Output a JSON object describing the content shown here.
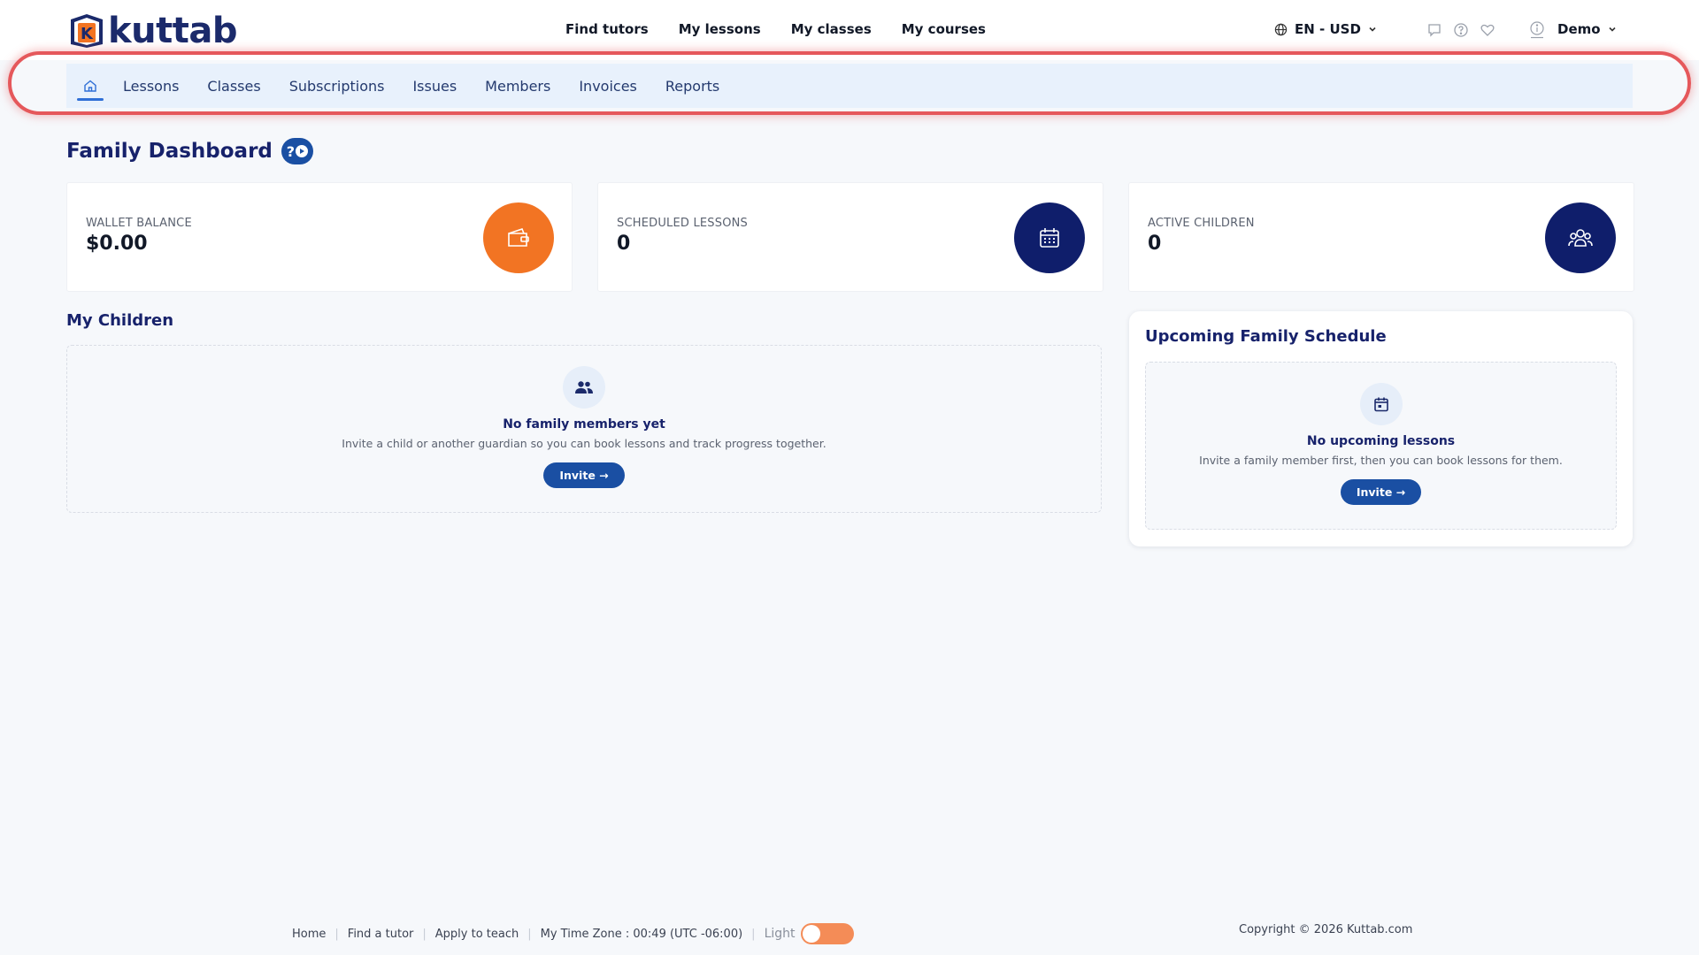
{
  "brand": {
    "name": "kuttab",
    "logo_letter": "K"
  },
  "topnav": [
    {
      "label": "Find tutors"
    },
    {
      "label": "My lessons"
    },
    {
      "label": "My classes"
    },
    {
      "label": "My courses"
    }
  ],
  "header": {
    "language_currency": "EN - USD",
    "user_name": "Demo"
  },
  "subnav": {
    "items": [
      {
        "label": "Lessons"
      },
      {
        "label": "Classes"
      },
      {
        "label": "Subscriptions"
      },
      {
        "label": "Issues"
      },
      {
        "label": "Members"
      },
      {
        "label": "Invoices"
      },
      {
        "label": "Reports"
      }
    ]
  },
  "page": {
    "title": "Family Dashboard",
    "help_glyph": "?"
  },
  "stats": [
    {
      "label": "WALLET BALANCE",
      "value": "$0.00",
      "icon": "wallet-icon",
      "color": "#f27423"
    },
    {
      "label": "SCHEDULED LESSONS",
      "value": "0",
      "icon": "calendar-icon",
      "color": "#0f1e6b"
    },
    {
      "label": "ACTIVE CHILDREN",
      "value": "0",
      "icon": "users-icon",
      "color": "#0f1e6b"
    }
  ],
  "children": {
    "title": "My Children",
    "empty_title": "No family members yet",
    "empty_desc": "Invite a child or another guardian so you can book lessons and track progress together.",
    "button": "Invite →"
  },
  "schedule": {
    "title": "Upcoming Family Schedule",
    "empty_title": "No upcoming lessons",
    "empty_desc": "Invite a family member first, then you can book lessons for them.",
    "button": "Invite →"
  },
  "footer": {
    "links": [
      {
        "label": "Home"
      },
      {
        "label": "Find a tutor"
      },
      {
        "label": "Apply to teach"
      }
    ],
    "timezone": "My Time Zone : 00:49 (UTC -06:00)",
    "theme_label": "Light",
    "copyright": "Copyright © 2026 Kuttab.com"
  },
  "colors": {
    "accent": "#1a4fa3",
    "brand_navy": "#17226b",
    "orange": "#f27423",
    "highlight": "#e5585b"
  }
}
